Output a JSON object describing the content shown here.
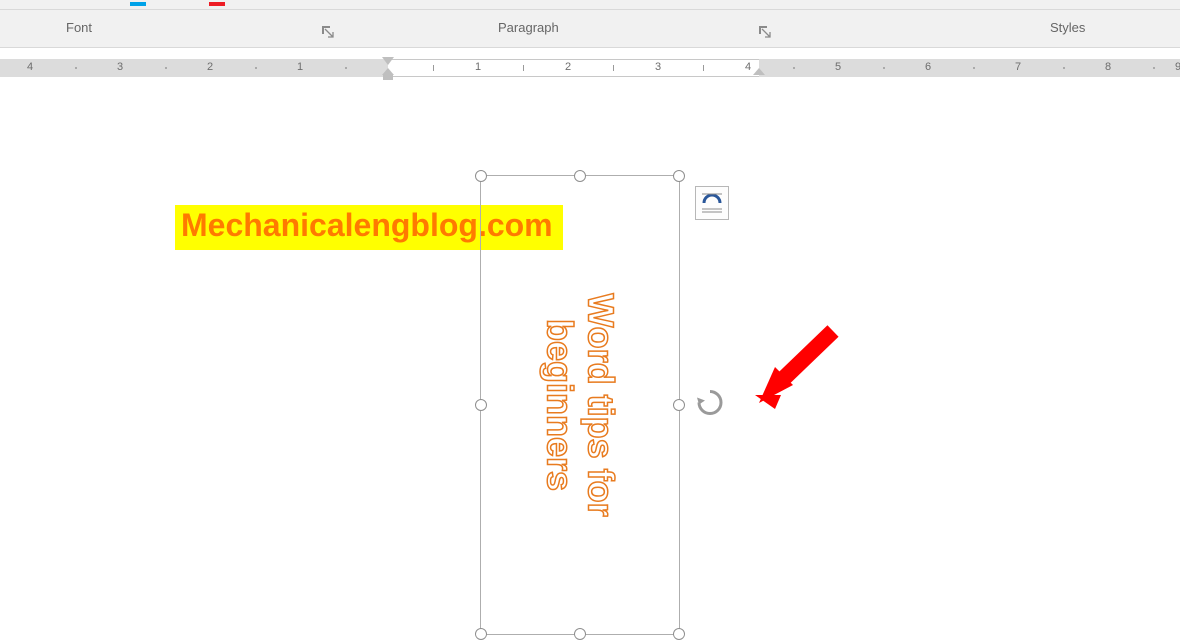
{
  "ribbon": {
    "groups": {
      "font": {
        "label": "Font"
      },
      "paragraph": {
        "label": "Paragraph"
      },
      "styles": {
        "label": "Styles"
      }
    }
  },
  "ruler": {
    "left_numbers": [
      4,
      3,
      2,
      1
    ],
    "right_numbers": [
      1,
      2,
      3,
      4,
      5,
      6,
      7,
      8,
      9
    ]
  },
  "watermark": {
    "text": "Mechanicalengblog.com"
  },
  "textbox": {
    "line1": "Word tips for",
    "line2": "beginners"
  },
  "icons": {
    "launcher": "dialog-launcher-icon",
    "layout": "layout-options-icon",
    "rotate": "rotate-handle-icon"
  }
}
